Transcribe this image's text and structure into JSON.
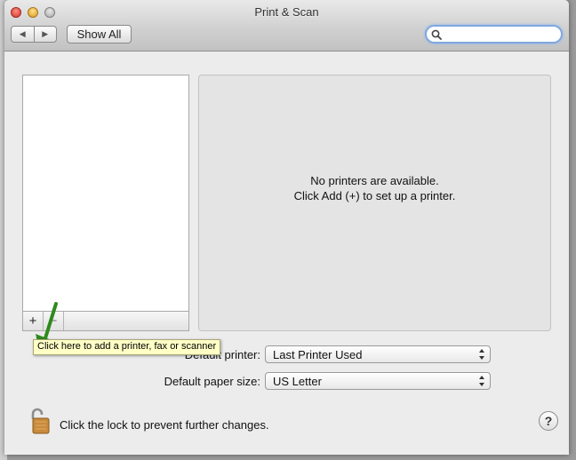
{
  "window": {
    "title": "Print & Scan"
  },
  "toolbar": {
    "back_glyph": "◀",
    "forward_glyph": "▶",
    "show_all_label": "Show All",
    "search_value": "",
    "search_placeholder": ""
  },
  "printer_list": {
    "add_glyph": "+",
    "remove_glyph": "−"
  },
  "detail": {
    "line1": "No printers are available.",
    "line2": "Click Add (+) to set up a printer."
  },
  "tooltip": {
    "text": "Click here to add a printer, fax or scanner"
  },
  "defaults": {
    "printer_label": "Default printer:",
    "printer_value": "Last Printer Used",
    "paper_label": "Default paper size:",
    "paper_value": "US Letter"
  },
  "footer": {
    "lock_text": "Click the lock to prevent further changes.",
    "help_glyph": "?"
  },
  "colors": {
    "annotation_arrow": "#2f8a1e",
    "tooltip_bg": "#ffffc6",
    "search_focus": "#7fa8e0"
  }
}
